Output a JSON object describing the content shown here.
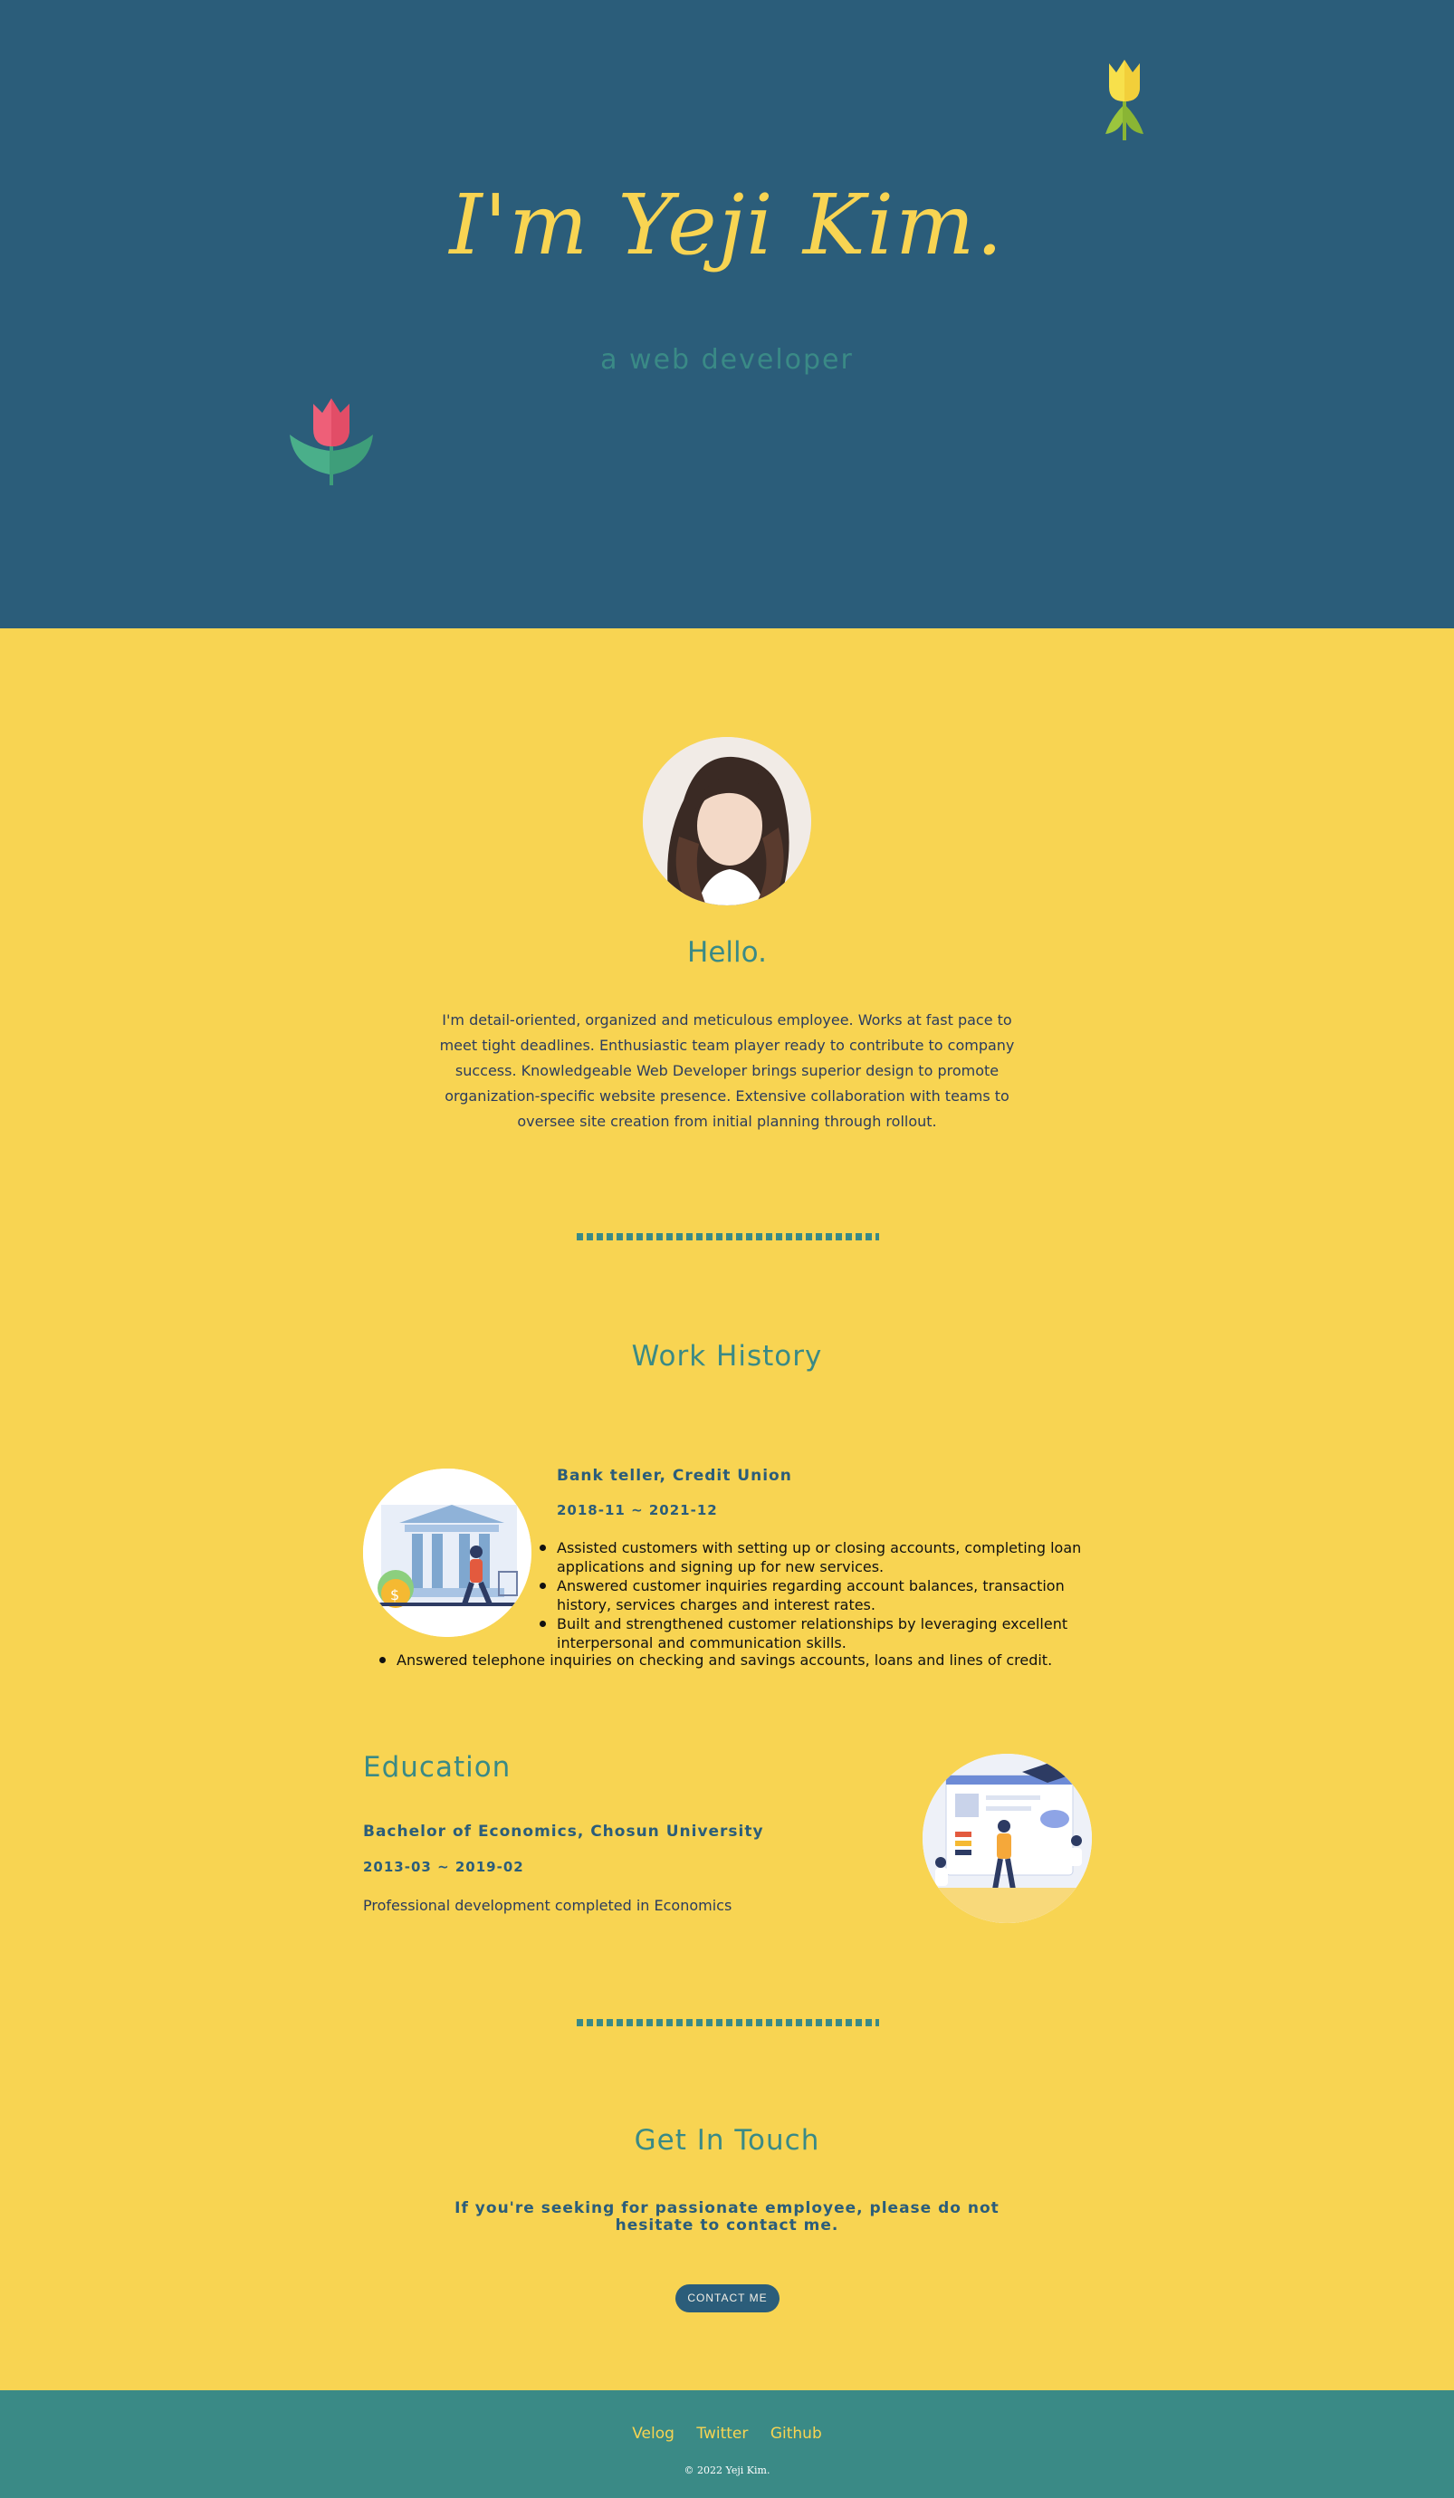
{
  "hero": {
    "title": "I'm Yeji Kim.",
    "subtitle": "a web developer"
  },
  "about": {
    "heading": "Hello.",
    "text": "I'm detail-oriented, organized and meticulous employee. Works at fast pace to meet tight deadlines. Enthusiastic team player ready to contribute to company success. Knowledgeable Web Developer brings superior design to promote organization-specific website presence. Extensive collaboration with teams to oversee site creation from initial planning through rollout."
  },
  "work": {
    "heading": "Work History",
    "job_title": "Bank teller, Credit Union",
    "job_dates": "2018-11 ~ 2021-12",
    "duties": [
      "Assisted customers with setting up or closing accounts, completing loan applications and signing up for new services.",
      "Answered customer inquiries regarding account balances, transaction history, services charges and interest rates.",
      "Built and strengthened customer relationships by leveraging excellent interpersonal and communication skills.",
      "Answered telephone inquiries on checking and savings accounts, loans and lines of credit."
    ],
    "image_icon": "bank-illustration-icon"
  },
  "education": {
    "heading": "Education",
    "degree": "Bachelor of Economics, Chosun University",
    "dates": "2013-03 ~ 2019-02",
    "description": "Professional development completed in Economics",
    "image_icon": "study-illustration-icon"
  },
  "contact": {
    "heading": "Get In Touch",
    "text": "If you're seeking for passionate employee, please do not hesitate to contact me.",
    "button_label": "CONTACT ME"
  },
  "footer": {
    "links": [
      "Velog",
      "Twitter",
      "Github"
    ],
    "copyright": "© 2022 Yeji Kim."
  },
  "colors": {
    "navy": "#2b5d7a",
    "yellow": "#f8d452",
    "teal": "#3a8a86"
  }
}
